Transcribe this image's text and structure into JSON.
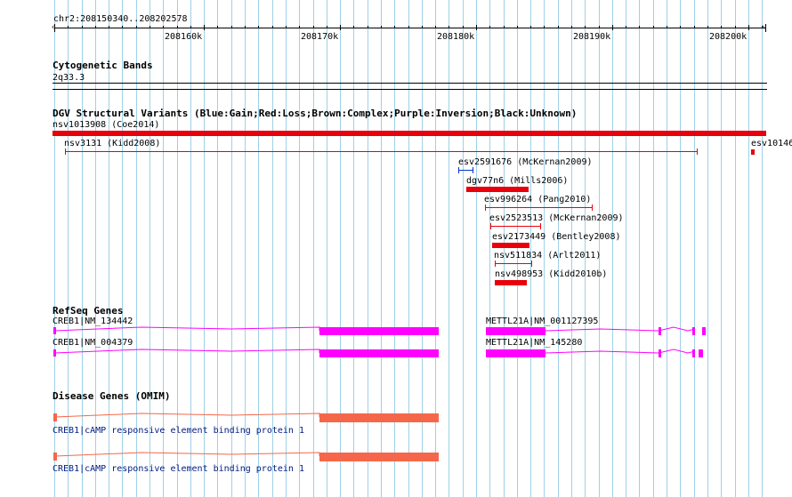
{
  "ruler": {
    "location": "chr2:208150340..208202578",
    "ticks": [
      "208160k",
      "208170k",
      "208180k",
      "208190k",
      "208200k"
    ]
  },
  "tracks": {
    "cytoband": {
      "title": "Cytogenetic Bands",
      "band": "2q33.3"
    },
    "dgv": {
      "title": "DGV Structural Variants (Blue:Gain;Red:Loss;Brown:Complex;Purple:Inversion;Black:Unknown)",
      "features": [
        {
          "label": "nsv1013908 (Coe2014)",
          "color": "#e8000b"
        },
        {
          "label": "nsv3131 (Kidd2008)",
          "color": "#e8000b"
        },
        {
          "label": "esv10146",
          "color": "#e8000b"
        },
        {
          "label": "esv2591676 (McKernan2009)",
          "color": "#0033cc"
        },
        {
          "label": "dgv77n6 (Mills2006)",
          "color": "#e8000b"
        },
        {
          "label": "esv996264 (Pang2010)",
          "color": "#e8000b"
        },
        {
          "label": "esv2523513 (McKernan2009)",
          "color": "#e8000b"
        },
        {
          "label": "esv2173449 (Bentley2008)",
          "color": "#e8000b"
        },
        {
          "label": "nsv511834 (Arlt2011)",
          "color": "#e8000b"
        },
        {
          "label": "nsv498953 (Kidd2010b)",
          "color": "#e8000b"
        }
      ]
    },
    "refseq": {
      "title": "RefSeq Genes",
      "color": "#ff00ff",
      "genes": [
        {
          "label": "CREB1|NM_134442"
        },
        {
          "label": "CREB1|NM_004379"
        },
        {
          "label": "METTL21A|NM_001127395"
        },
        {
          "label": "METTL21A|NM_145280"
        }
      ]
    },
    "omim": {
      "title": "Disease Genes (OMIM)",
      "color": "#f5674a",
      "genes": [
        {
          "desc": "CREB1|cAMP responsive element binding protein 1"
        },
        {
          "desc": "CREB1|cAMP responsive element binding protein 1"
        }
      ]
    }
  }
}
